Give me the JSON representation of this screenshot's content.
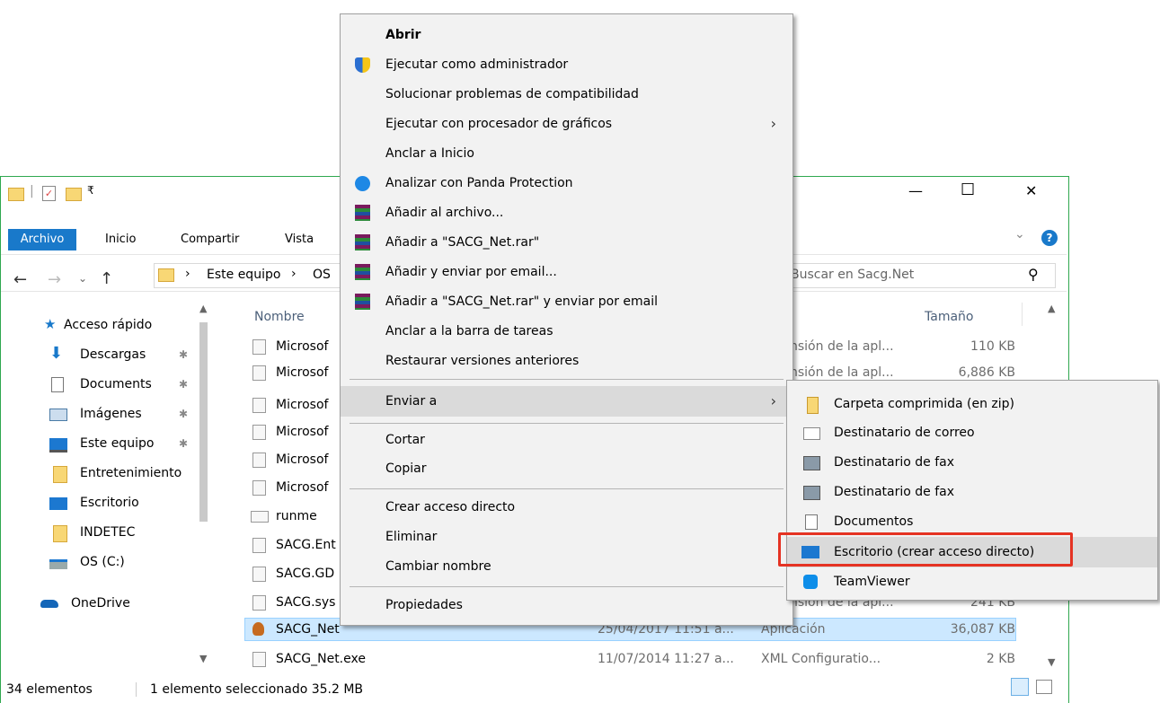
{
  "window": {
    "qat_sep": "|",
    "minimize": "—",
    "maximize": "☐",
    "close": "✕"
  },
  "ribbon": {
    "tabs": [
      "Archivo",
      "Inicio",
      "Compartir",
      "Vista"
    ],
    "expand": "⌄",
    "help": "?"
  },
  "address": {
    "back": "←",
    "forward": "→",
    "recent": "⌄",
    "up": "↑",
    "sep": "›",
    "crumb1": "Este equipo",
    "crumb2": "OS",
    "search_placeholder": "Buscar en Sacg.Net",
    "search_icon": "⚲"
  },
  "sidebar": {
    "items": [
      {
        "label": "Acceso rápido",
        "icon": "star-icon"
      },
      {
        "label": "Descargas",
        "icon": "download-icon",
        "pinned": true
      },
      {
        "label": "Documents",
        "icon": "document-icon",
        "pinned": true
      },
      {
        "label": "Imágenes",
        "icon": "pictures-icon",
        "pinned": true
      },
      {
        "label": "Este equipo",
        "icon": "computer-icon",
        "pinned": true
      },
      {
        "label": "Entretenimiento",
        "icon": "folder-icon"
      },
      {
        "label": "Escritorio",
        "icon": "desktop-icon"
      },
      {
        "label": "INDETEC",
        "icon": "folder-icon"
      },
      {
        "label": "OS (C:)",
        "icon": "drive-icon"
      },
      {
        "label": "OneDrive",
        "icon": "cloud-icon"
      }
    ],
    "pin_glyph": "✱"
  },
  "columns": {
    "name": "Nombre",
    "size": "Tamaño"
  },
  "files": [
    {
      "name": "Microsof",
      "type": "nsión de la apl...",
      "size": "110 KB"
    },
    {
      "name": "Microsof",
      "type": "nsión de la apl...",
      "size": "6,886 KB"
    },
    {
      "name": "Microsof",
      "type": "",
      "size": ""
    },
    {
      "name": "Microsof",
      "type": "",
      "size": ""
    },
    {
      "name": "Microsof",
      "type": "",
      "size": ""
    },
    {
      "name": "Microsof",
      "type": "",
      "size": ""
    },
    {
      "name": "runme",
      "type": "",
      "size": ""
    },
    {
      "name": "SACG.Ent",
      "type": "",
      "size": ""
    },
    {
      "name": "SACG.GD",
      "type": "",
      "size": ""
    },
    {
      "name": "SACG.sys",
      "type": "nsión de la apl...",
      "size": "241 KB"
    },
    {
      "name": "SACG_Net",
      "date": "25/04/2017 11:51 a...",
      "type": "Aplicación",
      "size": "36,087 KB",
      "selected": true
    },
    {
      "name": "SACG_Net.exe",
      "date": "11/07/2014 11:27 a...",
      "type": "XML Configuratio...",
      "size": "2 KB"
    }
  ],
  "status": {
    "count": "34 elementos",
    "selection": "1 elemento seleccionado 35.2 MB"
  },
  "context_menu": {
    "items": [
      {
        "label": "Abrir",
        "bold": true
      },
      {
        "label": "Ejecutar como administrador",
        "icon": "uac-shield-icon"
      },
      {
        "label": "Solucionar problemas de compatibilidad"
      },
      {
        "label": "Ejecutar con procesador de gráficos",
        "submenu": true
      },
      {
        "label": "Anclar a Inicio"
      },
      {
        "label": "Analizar con Panda Protection",
        "icon": "panda-icon"
      },
      {
        "label": "Añadir al archivo...",
        "icon": "winrar-icon"
      },
      {
        "label": "Añadir a \"SACG_Net.rar\"",
        "icon": "winrar-icon"
      },
      {
        "label": "Añadir y enviar por email...",
        "icon": "winrar-icon"
      },
      {
        "label": "Añadir a \"SACG_Net.rar\" y enviar por email",
        "icon": "winrar-icon"
      },
      {
        "label": "Anclar a la barra de tareas"
      },
      {
        "label": "Restaurar versiones anteriores"
      },
      {
        "label": "Enviar a",
        "submenu": true,
        "highlighted": true
      },
      {
        "label": "Cortar"
      },
      {
        "label": "Copiar"
      },
      {
        "label": "Crear acceso directo"
      },
      {
        "label": "Eliminar"
      },
      {
        "label": "Cambiar nombre"
      },
      {
        "label": "Propiedades"
      }
    ],
    "submenu_arrow": "›"
  },
  "send_to_menu": {
    "items": [
      {
        "label": "Carpeta comprimida (en zip)",
        "icon": "zip-folder-icon"
      },
      {
        "label": "Destinatario de correo",
        "icon": "mail-icon"
      },
      {
        "label": "Destinatario de fax",
        "icon": "fax-icon"
      },
      {
        "label": "Destinatario de fax",
        "icon": "fax-icon"
      },
      {
        "label": "Documentos",
        "icon": "document-icon"
      },
      {
        "label": "Escritorio (crear acceso directo)",
        "icon": "desktop-icon",
        "highlighted": true,
        "annotated": true
      },
      {
        "label": "TeamViewer",
        "icon": "teamviewer-icon"
      }
    ]
  },
  "colors": {
    "window_border": "#2fa84f",
    "ribbon_file_tab": "#1979ca",
    "selection": "#cce8ff",
    "menu_bg": "#f2f2f2",
    "menu_highlight": "#dadada",
    "annotation_box": "#e53323"
  }
}
